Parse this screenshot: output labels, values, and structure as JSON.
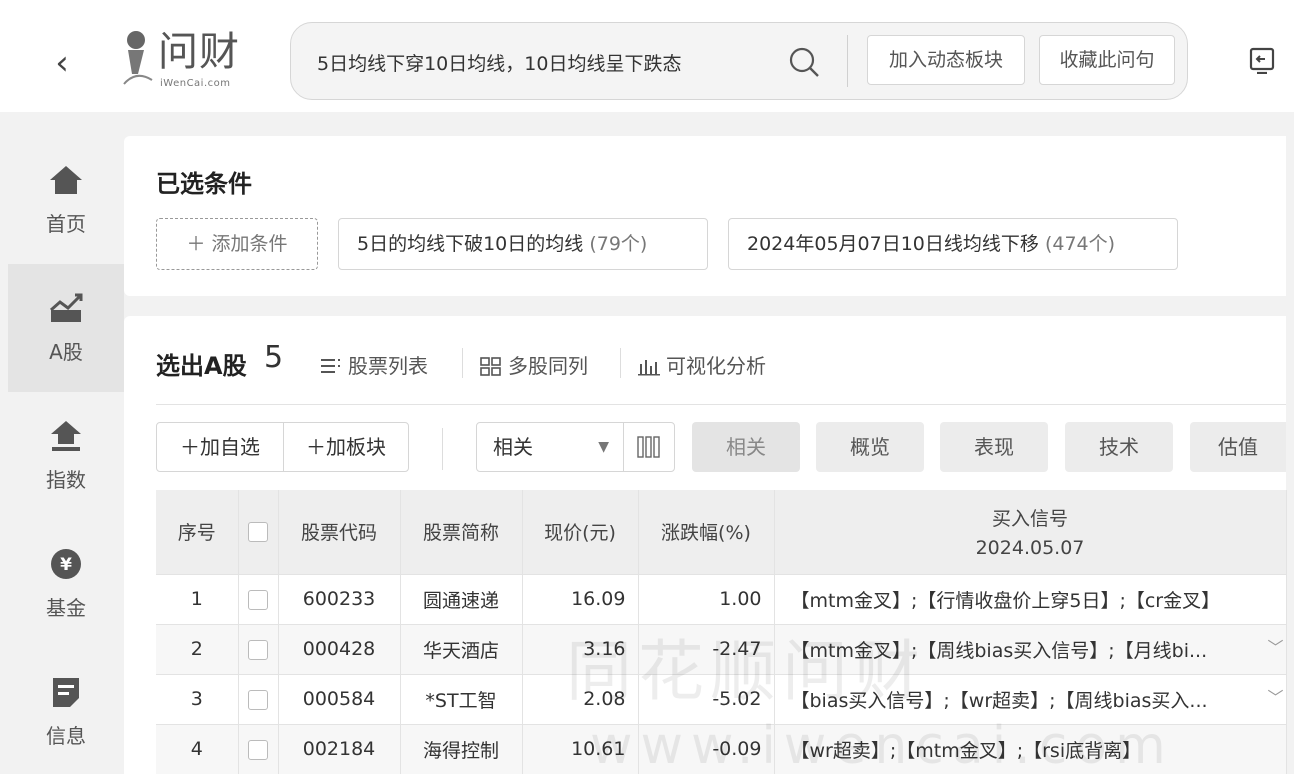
{
  "topbar": {
    "back": "‹",
    "logo_text": "问财",
    "logo_sub": "iWenCai.com",
    "query": "5日均线下穿10日均线，10日均线呈下跌态",
    "add_dynamic_label": "加入动态板块",
    "favorite_label": "收藏此问句"
  },
  "sidebar": {
    "items": [
      {
        "label": "首页",
        "icon": "home-icon"
      },
      {
        "label": "A股",
        "icon": "stock-chart-icon"
      },
      {
        "label": "指数",
        "icon": "index-icon"
      },
      {
        "label": "基金",
        "icon": "fund-icon"
      },
      {
        "label": "信息",
        "icon": "info-icon"
      }
    ],
    "active": "A股"
  },
  "conditions": {
    "title": "已选条件",
    "add_label": "＋ 添加条件",
    "chips": [
      {
        "text": "5日的均线下破10日的均线",
        "count": "(79个)"
      },
      {
        "text": "2024年05月07日10日线均线下移",
        "count": "(474个)"
      }
    ]
  },
  "results": {
    "title": "选出A股",
    "count": "5",
    "views": [
      "股票列表",
      "多股同列",
      "可视化分析"
    ],
    "toolbar": {
      "add_self": "加自选",
      "add_block": "加板块",
      "select_value": "相关"
    },
    "categories": [
      "相关",
      "概览",
      "表现",
      "技术",
      "估值"
    ],
    "columns": {
      "index": "序号",
      "code": "股票代码",
      "name": "股票简称",
      "price": "现价(元)",
      "change": "涨跌幅(%)",
      "signal": "买入信号",
      "signal_date": "2024.05.07"
    },
    "rows": [
      {
        "index": "1",
        "code": "600233",
        "name": "圆通速递",
        "price": "16.09",
        "change": "1.00",
        "signal": "【mtm金叉】;【行情收盘价上穿5日】;【cr金叉】"
      },
      {
        "index": "2",
        "code": "000428",
        "name": "华天酒店",
        "price": "3.16",
        "change": "-2.47",
        "signal": "【mtm金叉】;【周线bias买入信号】;【月线bi..."
      },
      {
        "index": "3",
        "code": "000584",
        "name": "*ST工智",
        "price": "2.08",
        "change": "-5.02",
        "signal": "【bias买入信号】;【wr超卖】;【周线bias买入..."
      },
      {
        "index": "4",
        "code": "002184",
        "name": "海得控制",
        "price": "10.61",
        "change": "-0.09",
        "signal": "【wr超卖】;【mtm金叉】;【rsi底背离】"
      }
    ]
  },
  "watermark": {
    "text": "同花顺问财",
    "sub": "www.iwencai.com"
  }
}
